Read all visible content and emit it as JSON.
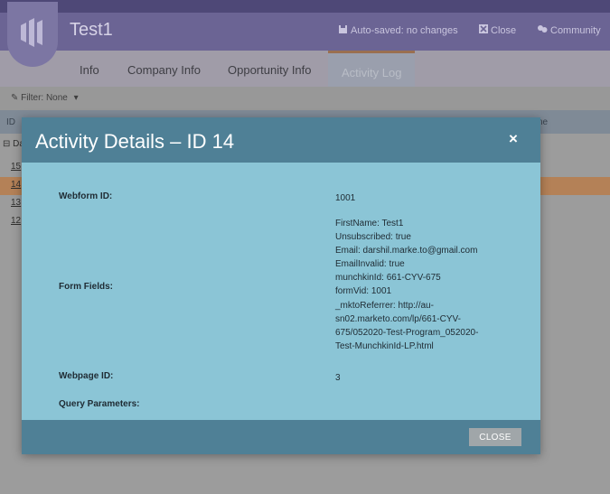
{
  "header": {
    "title": "Test1",
    "autosaved": "Auto-saved: no changes",
    "close": "Close",
    "community": "Community"
  },
  "tabs": [
    {
      "label": "Info"
    },
    {
      "label": "Company Info"
    },
    {
      "label": "Opportunity Info"
    },
    {
      "label": "Activity Log",
      "active": true
    }
  ],
  "filter": {
    "label": "Filter: None"
  },
  "grid": {
    "header_first": "ID",
    "header_partial": "ne",
    "group_label": "Da",
    "rows": [
      "15",
      "14",
      "13",
      "12"
    ],
    "highlight_color": "#b48157"
  },
  "modal": {
    "title": "Activity Details – ID 14",
    "close_x": "×",
    "fields": [
      {
        "label": "Webform ID:",
        "value": "1001"
      },
      {
        "label": "Form Fields:",
        "value_lines": [
          "FirstName: Test1",
          "Unsubscribed: true",
          "Email: darshil.marke.to@gmail.com",
          "EmailInvalid: true",
          "munchkinId: 661-CYV-675",
          "formVid: 1001",
          "_mktoReferrer: http://au-",
          "sn02.marketo.com/lp/661-CYV-",
          "675/052020-Test-Program_052020-",
          "Test-MunchkinId-LP.html"
        ]
      },
      {
        "label": "Webpage ID:",
        "value": "3"
      },
      {
        "label": "Query Parameters:",
        "value": ""
      }
    ],
    "close_button": "CLOSE"
  },
  "colors": {
    "modal_header": "#4f8096",
    "modal_body": "#8bc5d6",
    "app_header": "#6b6494"
  }
}
